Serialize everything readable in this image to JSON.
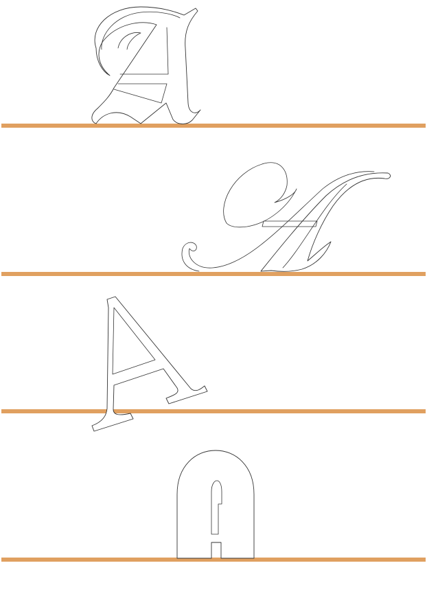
{
  "colors": {
    "baseline": "#e0a060",
    "glyph_fill": "#ffffff",
    "glyph_stroke": "#333333",
    "background": "#ffffff"
  },
  "rows": [
    {
      "glyph_style": "blackletter-capital-a-outline"
    },
    {
      "glyph_style": "script-capital-a-outline"
    },
    {
      "glyph_style": "italic-serif-capital-a-outline"
    },
    {
      "glyph_style": "rounded-display-capital-a-outline"
    }
  ]
}
